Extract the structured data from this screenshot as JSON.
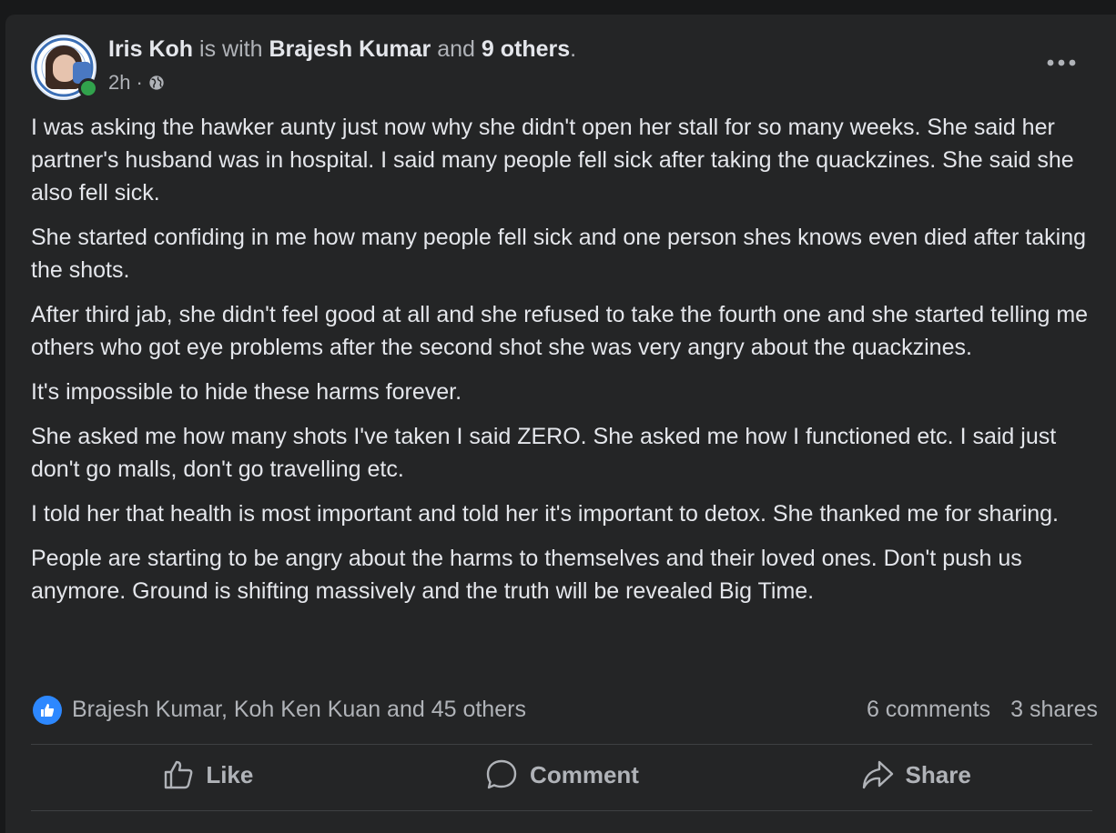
{
  "post": {
    "author": "Iris Koh",
    "with_text": " is with ",
    "tagged": "Brajesh Kumar",
    "and_text": " and ",
    "others": "9 others",
    "period": ".",
    "time": "2h",
    "separator": "·",
    "visibility_icon": "globe-icon",
    "more_icon": "more-horizontal-icon",
    "paragraphs": [
      "I was asking the hawker aunty just now why she didn't open her stall for so many weeks. She said her partner's husband was in hospital. I said many people fell sick after taking the quackzines. She said she also fell sick.",
      "She started confiding in me how many people fell sick and one person shes knows even died after taking the shots.",
      "After third jab, she didn't feel good at all and she refused to take the fourth one and she started telling me others who got eye problems after the second shot she was very angry about the quackzines.",
      "It's impossible to hide these harms forever.",
      "She asked me how many shots I've taken I said ZERO. She asked me how I functioned etc. I said just don't go malls, don't go travelling etc.",
      "I told her that health is most important and told her it's important to detox. She thanked me for sharing.",
      "People are starting to be angry about the harms to themselves and their loved ones. Don't push us anymore. Ground is shifting massively and the truth will be revealed Big Time."
    ]
  },
  "reactions": {
    "names": "Brajesh Kumar, Koh Ken Kuan and 45 others",
    "comments": "6 comments",
    "shares": "3 shares"
  },
  "actions": {
    "like": "Like",
    "comment": "Comment",
    "share": "Share"
  },
  "colors": {
    "background": "#18191a",
    "card": "#242526",
    "primary_text": "#e4e6eb",
    "secondary_text": "#b0b3b8",
    "like_blue": "#2d88ff",
    "online_green": "#31a24c"
  }
}
